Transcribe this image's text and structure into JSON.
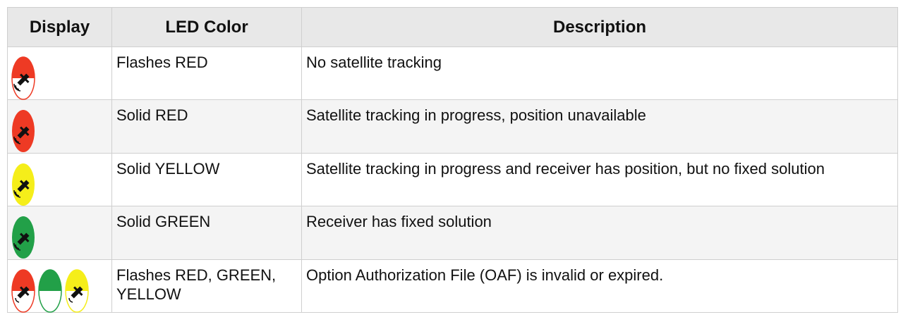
{
  "table": {
    "headers": [
      "Display",
      "LED Color",
      "Description"
    ],
    "rows": [
      {
        "icon": "led-red-flashing-icon",
        "color": "Flashes RED",
        "description": "No satellite tracking"
      },
      {
        "icon": "led-red-solid-icon",
        "color": "Solid RED",
        "description": "Satellite tracking in progress, position unavailable"
      },
      {
        "icon": "led-yellow-solid-icon",
        "color": "Solid YELLOW",
        "description": "Satellite tracking in progress and receiver has position, but no fixed solution"
      },
      {
        "icon": "led-green-solid-icon",
        "color": "Solid GREEN",
        "description": "Receiver has fixed solution"
      },
      {
        "icon": "led-red-green-yellow-flashing-icon",
        "color": "Flashes RED, GREEN, YELLOW",
        "description": "Option Authorization File (OAF) is invalid or expired."
      }
    ]
  },
  "colors": {
    "red": "#ee3a24",
    "yellow": "#f5ee1a",
    "green": "#22a048",
    "header_bg": "#e8e8e8",
    "stripe_bg": "#f4f4f4"
  }
}
